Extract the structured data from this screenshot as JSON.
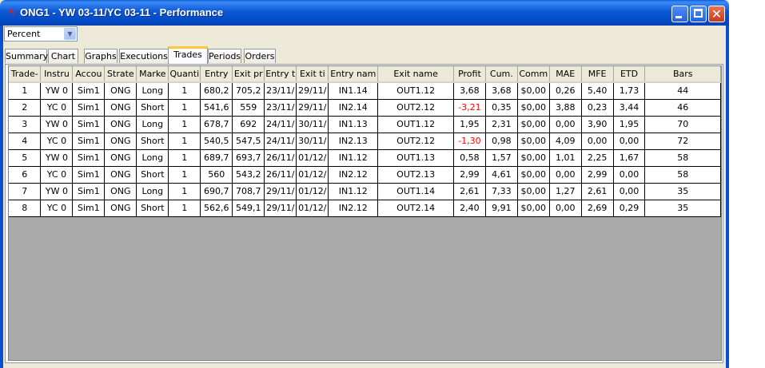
{
  "window": {
    "title": "ONG1 - YW 03-11/YC 03-11 - Performance",
    "icon": "app-logo-icon"
  },
  "display_mode": {
    "selected": "Percent"
  },
  "tabs": [
    {
      "label": "Summary",
      "active": false
    },
    {
      "label": "Chart",
      "active": false
    },
    {
      "label": "Graphs",
      "active": false
    },
    {
      "label": "Executions",
      "active": false
    },
    {
      "label": "Trades",
      "active": true
    },
    {
      "label": "Periods",
      "active": false
    },
    {
      "label": "Orders",
      "active": false
    }
  ],
  "table": {
    "columns": [
      "Trade-",
      "Instru",
      "Accou",
      "Strate",
      "Marke",
      "Quanti",
      "Entry",
      "Exit pr",
      "Entry t",
      "Exit ti",
      "Entry nam",
      "Exit name",
      "Profit",
      "Cum.",
      "Comm",
      "MAE",
      "MFE",
      "ETD",
      "Bars"
    ],
    "rows": [
      [
        "1",
        "YW 0",
        "Sim1",
        "ONG",
        "Long",
        "1",
        "680,2",
        "705,2",
        "23/11/",
        "29/11/",
        "IN1.14",
        "OUT1.12",
        "3,68",
        "3,68",
        "$0,00",
        "0,26",
        "5,40",
        "1,73",
        "44"
      ],
      [
        "2",
        "YC 0",
        "Sim1",
        "ONG",
        "Short",
        "1",
        "541,6",
        "559",
        "23/11/",
        "29/11/",
        "IN2.14",
        "OUT2.12",
        "-3,21",
        "0,35",
        "$0,00",
        "3,88",
        "0,23",
        "3,44",
        "46"
      ],
      [
        "3",
        "YW 0",
        "Sim1",
        "ONG",
        "Long",
        "1",
        "678,7",
        "692",
        "24/11/",
        "30/11/",
        "IN1.13",
        "OUT1.12",
        "1,95",
        "2,31",
        "$0,00",
        "0,00",
        "3,90",
        "1,95",
        "70"
      ],
      [
        "4",
        "YC 0",
        "Sim1",
        "ONG",
        "Short",
        "1",
        "540,5",
        "547,5",
        "24/11/",
        "30/11/",
        "IN2.13",
        "OUT2.12",
        "-1,30",
        "0,98",
        "$0,00",
        "4,09",
        "0,00",
        "0,00",
        "72"
      ],
      [
        "5",
        "YW 0",
        "Sim1",
        "ONG",
        "Long",
        "1",
        "689,7",
        "693,7",
        "26/11/",
        "01/12/",
        "IN1.12",
        "OUT1.13",
        "0,58",
        "1,57",
        "$0,00",
        "1,01",
        "2,25",
        "1,67",
        "58"
      ],
      [
        "6",
        "YC 0",
        "Sim1",
        "ONG",
        "Short",
        "1",
        "560",
        "543,2",
        "26/11/",
        "01/12/",
        "IN2.12",
        "OUT2.13",
        "2,99",
        "4,61",
        "$0,00",
        "0,00",
        "2,99",
        "0,00",
        "58"
      ],
      [
        "7",
        "YW 0",
        "Sim1",
        "ONG",
        "Long",
        "1",
        "690,7",
        "708,7",
        "29/11/",
        "01/12/",
        "IN1.12",
        "OUT1.14",
        "2,61",
        "7,33",
        "$0,00",
        "1,27",
        "2,61",
        "0,00",
        "35"
      ],
      [
        "8",
        "YC 0",
        "Sim1",
        "ONG",
        "Short",
        "1",
        "562,6",
        "549,1",
        "29/11/",
        "01/12/",
        "IN2.12",
        "OUT2.14",
        "2,40",
        "9,91",
        "$0,00",
        "0,00",
        "2,69",
        "0,29",
        "35"
      ]
    ]
  },
  "colors": {
    "negative_profit": "#ff0000",
    "grid_background": "#aaaaaa",
    "title_bar": "#0a5ed8"
  }
}
